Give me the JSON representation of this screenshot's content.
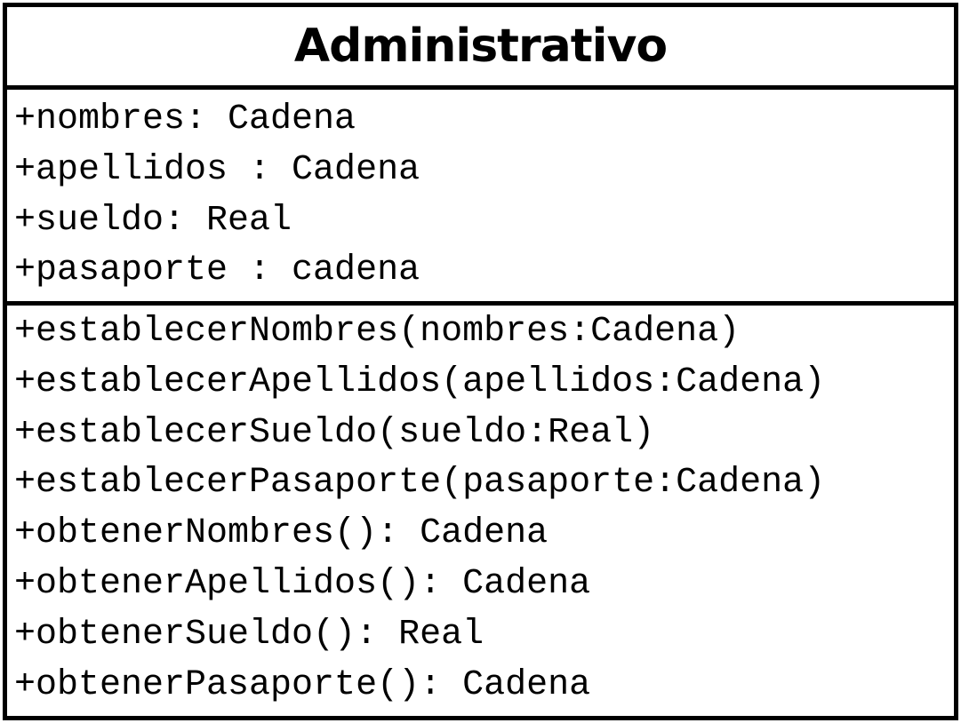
{
  "class": {
    "name": "Administrativo",
    "attributes": [
      "+nombres: Cadena",
      "+apellidos : Cadena",
      "+sueldo: Real",
      "+pasaporte : cadena"
    ],
    "methods": [
      "+establecerNombres(nombres:Cadena)",
      "+establecerApellidos(apellidos:Cadena)",
      "+establecerSueldo(sueldo:Real)",
      "+establecerPasaporte(pasaporte:Cadena)",
      "+obtenerNombres(): Cadena",
      "+obtenerApellidos(): Cadena",
      "+obtenerSueldo(): Real",
      "+obtenerPasaporte(): Cadena"
    ]
  }
}
